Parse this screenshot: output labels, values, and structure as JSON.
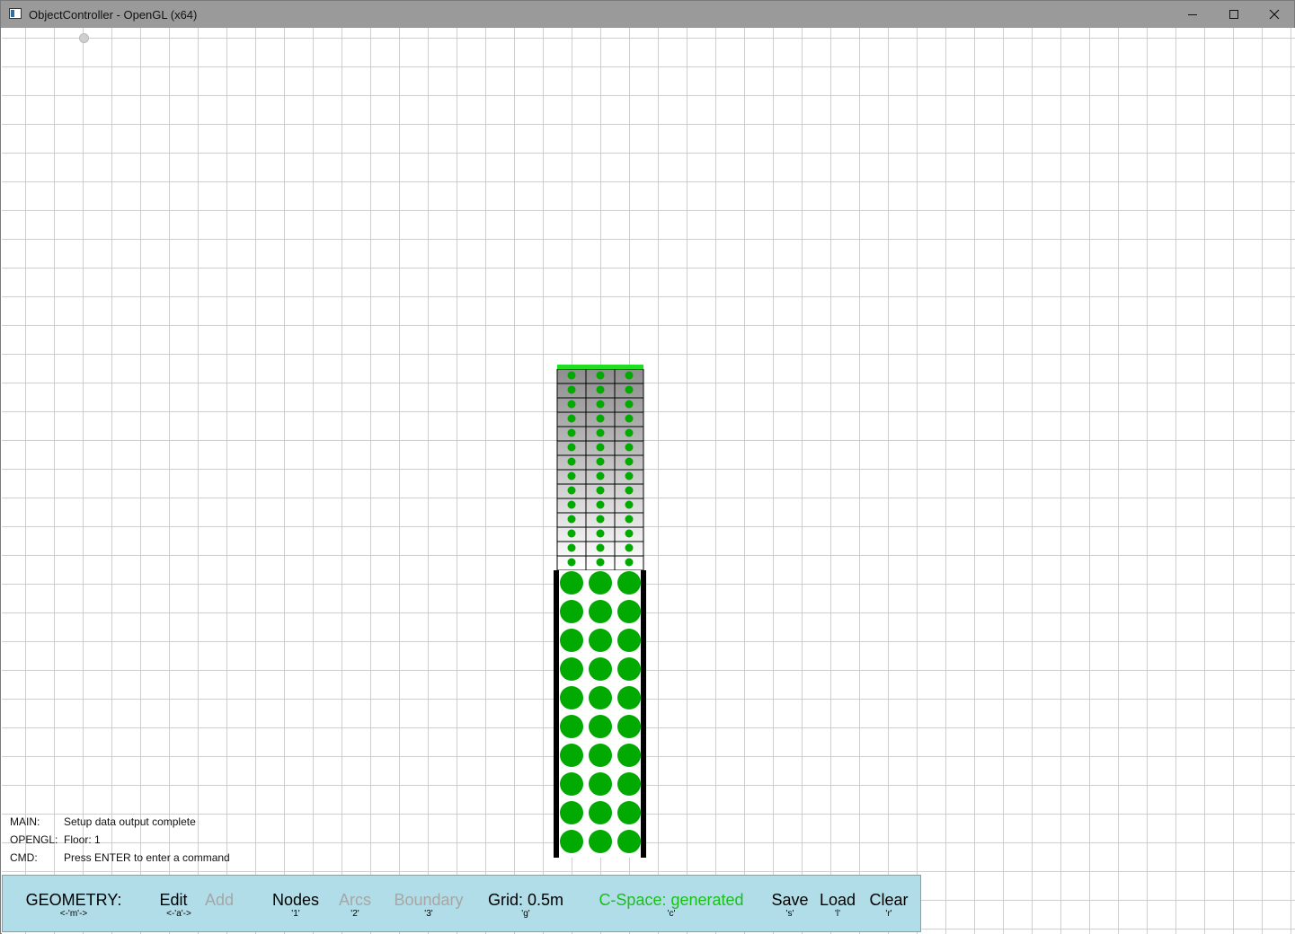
{
  "window": {
    "title": "ObjectController - OpenGL (x64)",
    "controls": {
      "minimize": "minimize",
      "maximize": "maximize",
      "close": "close"
    }
  },
  "console": [
    {
      "key": "MAIN:",
      "value": "Setup data output complete"
    },
    {
      "key": "OPENGL:",
      "value": "Floor: 1"
    },
    {
      "key": "CMD:",
      "value": "Press ENTER to enter a command"
    }
  ],
  "toolbar": {
    "mode": {
      "label": "GEOMETRY:",
      "key": "<-'m'->"
    },
    "edit": {
      "label": "Edit",
      "key": "<-'a'->"
    },
    "add": {
      "label": "Add"
    },
    "nodes": {
      "label": "Nodes",
      "key": "'1'"
    },
    "arcs": {
      "label": "Arcs",
      "key": "'2'"
    },
    "boundary": {
      "label": "Boundary",
      "key": "'3'"
    },
    "grid": {
      "label": "Grid: 0.5m",
      "key": "'g'"
    },
    "cspace": {
      "label": "C-Space: generated",
      "key": "'c'"
    },
    "save": {
      "label": "Save",
      "key": "'s'"
    },
    "load": {
      "label": "Load",
      "key": "'l'"
    },
    "clear": {
      "label": "Clear",
      "key": "'r'"
    }
  },
  "colors": {
    "node_green": "#00aa00",
    "cspace_bar": "#22dd22",
    "toolbar_bg": "#b0dde8",
    "grid_line": "#cfcfcf",
    "wall": "#000000"
  }
}
